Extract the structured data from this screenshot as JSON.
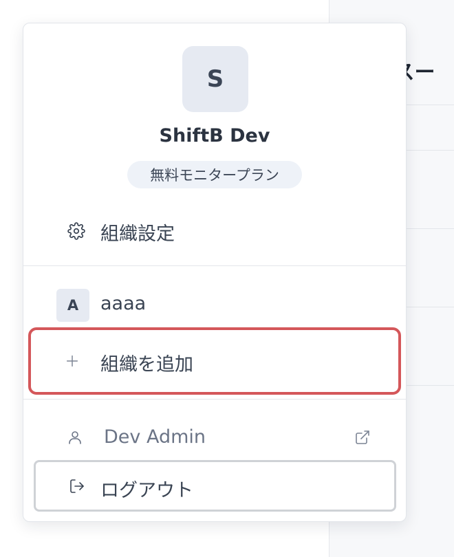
{
  "background": {
    "title_fragment": "-スー"
  },
  "popover": {
    "org_avatar_letter": "S",
    "org_name": "ShiftB Dev",
    "plan_badge": "無料モニタープラン",
    "settings_label": "組織設定",
    "orgs": [
      {
        "letter": "A",
        "name": "aaaa"
      }
    ],
    "add_org_label": "組織を追加",
    "user_name": "Dev Admin",
    "logout_label": "ログアウト"
  },
  "icons": {
    "settings": "gear-icon",
    "add": "plus-icon",
    "user": "user-icon",
    "external": "external-link-icon",
    "logout": "logout-icon"
  },
  "colors": {
    "highlight": "#d4575a",
    "badge_bg": "#eef2f8",
    "avatar_bg": "#e6eaf2"
  }
}
